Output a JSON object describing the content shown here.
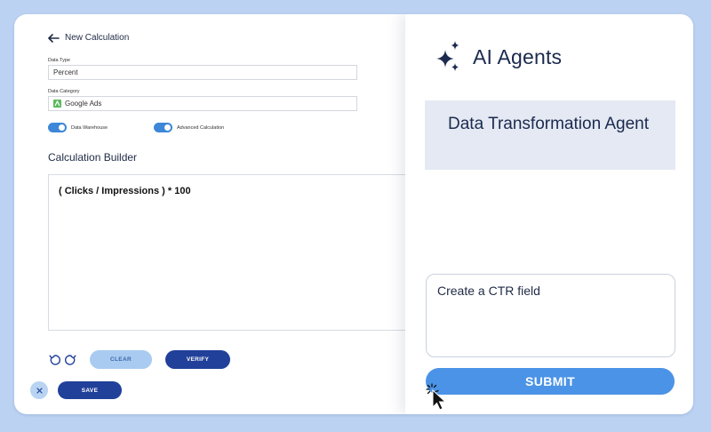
{
  "header": {
    "back_label": "New Calculation"
  },
  "form": {
    "data_type": {
      "label": "Data Type",
      "value": "Percent"
    },
    "data_category": {
      "label": "Data Category",
      "value": "Google Ads"
    },
    "toggles": [
      {
        "label": "Data Warehouse",
        "on": true
      },
      {
        "label": "Advanced Calculation",
        "on": true
      }
    ],
    "section_title": "Calculation Builder",
    "formula": "( Clicks / Impressions ) * 100"
  },
  "actions": {
    "clear": "CLEAR",
    "verify": "VERIFY",
    "save": "SAVE"
  },
  "panel": {
    "title": "AI Agents",
    "agent_name": "Data Transformation Agent",
    "prompt_value": "Create a CTR field",
    "submit": "SUBMIT"
  },
  "colors": {
    "background": "#bcd2f2",
    "primary": "#21409a",
    "accent": "#4b93e6",
    "light_accent": "#a9cbf1",
    "agent_card": "#e4e9f3"
  }
}
